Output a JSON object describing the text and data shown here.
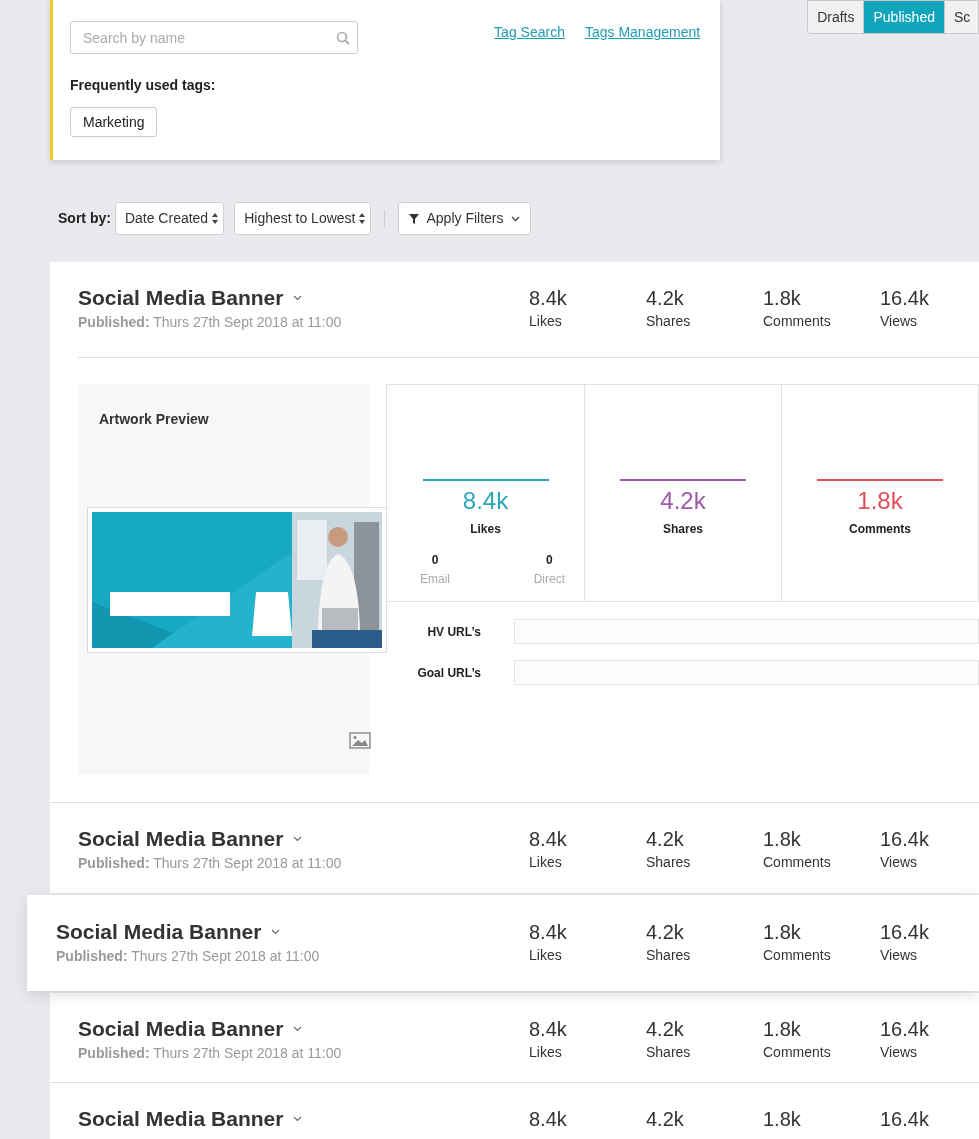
{
  "search": {
    "placeholder": "Search by name"
  },
  "links": [
    "Tag Search",
    "Tags Management"
  ],
  "tags_heading": "Frequently used tags:",
  "tags": [
    "Marketing"
  ],
  "status_tabs": [
    {
      "label": "Drafts",
      "selected": false
    },
    {
      "label": "Published",
      "selected": true
    },
    {
      "label": "Sc",
      "selected": false
    }
  ],
  "sort": {
    "label": "Sort by:",
    "field": "Date Created",
    "order": "Highest to Lowest",
    "filter_button": "Apply Filters"
  },
  "posts": [
    {
      "title": "Social Media Banner",
      "published_label": "Published:",
      "published": "Thurs 27th Sept 2018 at 11:00",
      "raised": false,
      "stats": [
        {
          "value": "8.4k",
          "label": "Likes"
        },
        {
          "value": "4.2k",
          "label": "Shares"
        },
        {
          "value": "1.8k",
          "label": "Comments"
        },
        {
          "value": "16.4k",
          "label": "Views"
        }
      ],
      "details": {
        "preview_title": "Artwork Preview",
        "preview": {
          "kind": "picture"
        },
        "metrics": [
          {
            "value": "8.4k",
            "label": "Likes",
            "color": "#2aa5b8",
            "breakdown": [
              {
                "value": "0",
                "label": "Email"
              },
              {
                "value": "0",
                "label": "Direct"
              }
            ]
          },
          {
            "value": "4.2k",
            "label": "Shares",
            "color": "#9b59a6"
          },
          {
            "value": "1.8k",
            "label": "Comments",
            "color": "#e0505a"
          }
        ],
        "url_fields": [
          "HV URL’s",
          "Goal URL’s"
        ]
      }
    },
    {
      "title": "Social Media Banner",
      "published_label": "Published:",
      "published": "Thurs 27th Sept 2018 at 11:00",
      "raised": false,
      "stats": [
        {
          "value": "8.4k",
          "label": "Likes"
        },
        {
          "value": "4.2k",
          "label": "Shares"
        },
        {
          "value": "1.8k",
          "label": "Comments"
        },
        {
          "value": "16.4k",
          "label": "Views"
        }
      ]
    },
    {
      "title": "Social Media Banner",
      "published_label": "Published:",
      "published": "Thurs 27th Sept 2018 at 11:00",
      "raised": true,
      "stats": [
        {
          "value": "8.4k",
          "label": "Likes"
        },
        {
          "value": "4.2k",
          "label": "Shares"
        },
        {
          "value": "1.8k",
          "label": "Comments"
        },
        {
          "value": "16.4k",
          "label": "Views"
        }
      ]
    },
    {
      "title": "Social Media Banner",
      "published_label": "Published:",
      "published": "Thurs 27th Sept 2018 at 11:00",
      "raised": false,
      "stats": [
        {
          "value": "8.4k",
          "label": "Likes"
        },
        {
          "value": "4.2k",
          "label": "Shares"
        },
        {
          "value": "1.8k",
          "label": "Comments"
        },
        {
          "value": "16.4k",
          "label": "Views"
        }
      ]
    },
    {
      "title": "Social Media Banner",
      "raised": false,
      "stats": [
        {
          "value": "8.4k"
        },
        {
          "value": "4.2k"
        },
        {
          "value": "1.8k"
        },
        {
          "value": "16.4k"
        }
      ]
    }
  ]
}
